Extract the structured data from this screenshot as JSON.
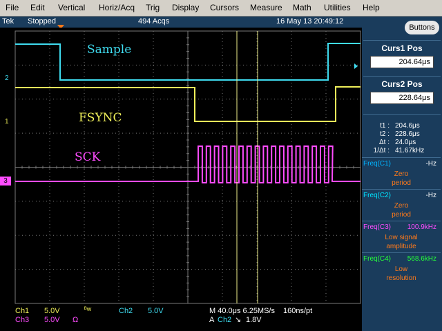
{
  "menu": [
    "File",
    "Edit",
    "Vertical",
    "Horiz/Acq",
    "Trig",
    "Display",
    "Cursors",
    "Measure",
    "Math",
    "Utilities",
    "Help"
  ],
  "status": {
    "brand": "Tek",
    "state": "Stopped",
    "acqs": "494 Acqs",
    "datetime": "16 May 13 20:49:12"
  },
  "side": {
    "buttons_label": "Buttons",
    "curs1": {
      "title": "Curs1 Pos",
      "value": "204.64μs"
    },
    "curs2": {
      "title": "Curs2 Pos",
      "value": "228.64μs"
    },
    "readouts": [
      {
        "label": "t1 :",
        "value": "204.6μs"
      },
      {
        "label": "t2 :",
        "value": "228.6μs"
      },
      {
        "label": "Δt :",
        "value": "24.0μs"
      },
      {
        "label": "1/Δt :",
        "value": "41.67kHz"
      }
    ],
    "freqs": [
      {
        "label": "Freq(C1)",
        "value": "-Hz",
        "desc1": "Zero",
        "desc2": "period",
        "color": "#00b4ff"
      },
      {
        "label": "Freq(C2)",
        "value": "-Hz",
        "desc1": "Zero",
        "desc2": "period",
        "color": "#00e4ff"
      },
      {
        "label": "Freq(C3)",
        "value": "100.9kHz",
        "desc1": "Low signal",
        "desc2": "amplitude",
        "color": "#ff4cff"
      },
      {
        "label": "Freq(C4)",
        "value": "568.6kHz",
        "desc1": "Low",
        "desc2": "resolution",
        "color": "#26ff3a"
      }
    ]
  },
  "waveforms": {
    "sample_label": "Sample",
    "fsync_label": "FSYNC",
    "sck_label": "SCK",
    "ch2_marker": "2",
    "ch1_marker": "1",
    "ch3_marker": "3"
  },
  "bottom": {
    "ch1": "Ch1",
    "ch1_scale": "5.0V",
    "bw": "ᴮw",
    "ch2": "Ch2",
    "ch2_scale": "5.0V",
    "ch3": "Ch3",
    "ch3_scale": "5.0V",
    "ohm": "Ω",
    "timebase": "M 40.0μs 6.25MS/s",
    "resolution": "160ns/pt",
    "trigger": "A",
    "trig_ch": "Ch2",
    "trig_level": "1.8V",
    "trig_slope": "↘"
  },
  "colors": {
    "ch1": "#f0f05a",
    "ch2": "#3fdcf0",
    "ch3": "#ff4cff",
    "grid": "#7a7a7a",
    "cursor": "#f0f08c"
  }
}
